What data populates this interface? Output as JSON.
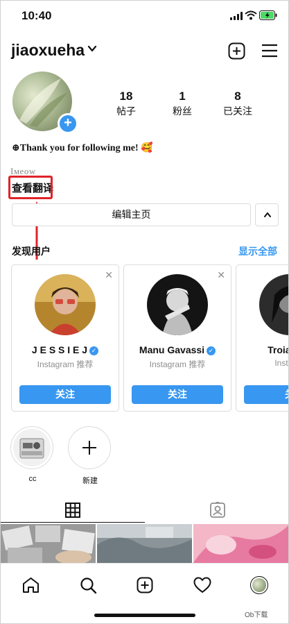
{
  "status_bar": {
    "time": "10:40"
  },
  "header": {
    "username": "jiaoxueha"
  },
  "stats": [
    {
      "num": "18",
      "label": "帖子"
    },
    {
      "num": "1",
      "label": "粉丝"
    },
    {
      "num": "8",
      "label": "已关注"
    }
  ],
  "bio": "⊕Thank you for following me! 🥰",
  "bio_second_line": "Iᴍeᴏᴡ",
  "translate_link": "查看翻译",
  "edit_profile": "编辑主页",
  "discover": {
    "title": "发现用户",
    "show_all": "显示全部"
  },
  "suggestions": [
    {
      "name": "J E S S I E J",
      "sub": "Instagram 推荐",
      "follow": "关注"
    },
    {
      "name": "Manu Gavassi",
      "sub": "Instagram 推荐",
      "follow": "关注"
    },
    {
      "name": "Troian Be",
      "sub": "Instagra",
      "follow": "关"
    }
  ],
  "highlights": [
    {
      "label": "cc"
    },
    {
      "label": "新建"
    }
  ],
  "watermark": "Ob下载",
  "colors": {
    "accent": "#3897f0",
    "annotation": "#e0232a"
  },
  "icons": [
    "signal-icon",
    "wifi-icon",
    "battery-icon",
    "chevron-down-icon",
    "add-post-icon",
    "menu-icon",
    "close-icon",
    "verified-icon",
    "plus-icon",
    "grid-icon",
    "tagged-icon",
    "home-icon",
    "search-icon",
    "create-icon",
    "heart-icon",
    "profile-avatar-icon",
    "arrow-annotation"
  ]
}
